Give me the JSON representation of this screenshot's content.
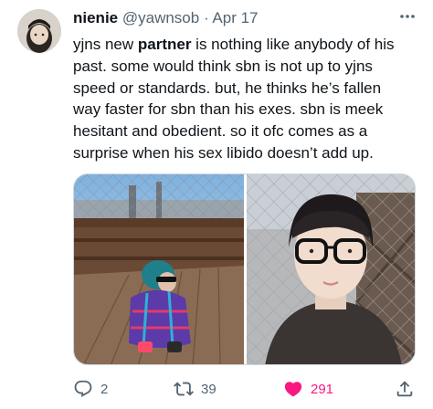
{
  "tweet": {
    "author_name": "nienie",
    "handle": "@yawnsob",
    "separator": "·",
    "date": "Apr 17",
    "text_lines": [
      [
        "yjns new ",
        "partner",
        " is nothing like anybody of his"
      ],
      [
        "past. some would think sbn is not up to yjns"
      ],
      [
        "speed or standards. but, he thinks he’s fallen"
      ],
      [
        "way faster for sbn than his exes. sbn is meek"
      ],
      [
        "hesitant and obedient. so it ofc comes as a"
      ],
      [
        "surprise when his sex libido doesn’t add up."
      ]
    ]
  },
  "media": {
    "photos": [
      {
        "name": "photo-bridge-crouching",
        "icon": "photo"
      },
      {
        "name": "photo-selfie-glasses",
        "icon": "photo"
      }
    ]
  },
  "actions": {
    "reply_count": "2",
    "retweet_count": "39",
    "like_count": "291",
    "like_color": "#f91880",
    "icon_color": "#536471"
  },
  "icons": {
    "more": "more-icon",
    "reply": "reply-icon",
    "retweet": "retweet-icon",
    "like": "heart-icon",
    "share": "share-icon"
  }
}
